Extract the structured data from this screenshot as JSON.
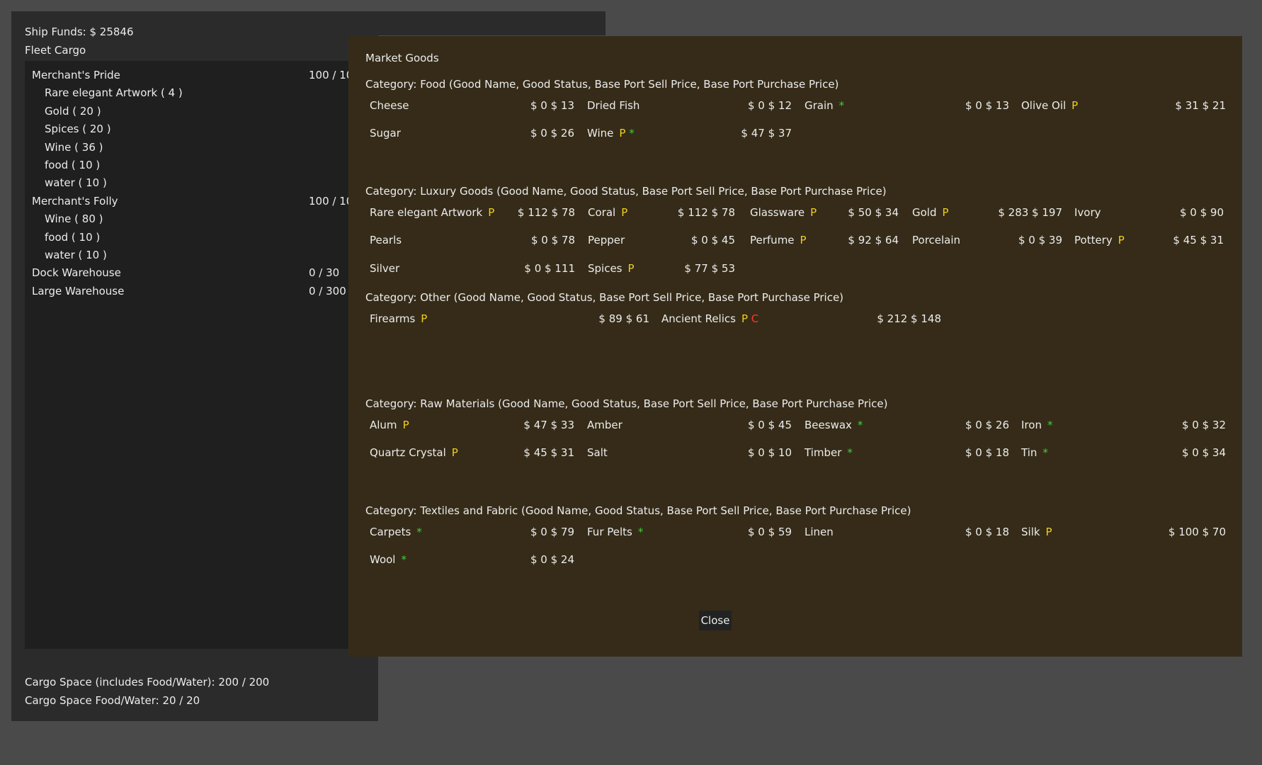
{
  "ship": {
    "funds_label": "Ship Funds: $",
    "funds_value": "25846",
    "fleet_cargo_label": "Fleet  Cargo",
    "cargo_space_label": "Cargo Space (includes Food/Water):",
    "cargo_space_value": "200 / 200",
    "food_water_label": "Cargo Space Food/Water:",
    "food_water_value": "20 / 20"
  },
  "fleet": [
    {
      "name": "Merchant's Pride",
      "capacity": "100 / 10",
      "sub": false
    },
    {
      "name": "Rare elegant Artwork ( 4 )",
      "sub": true
    },
    {
      "name": "Gold ( 20 )",
      "sub": true
    },
    {
      "name": "Spices ( 20 )",
      "sub": true
    },
    {
      "name": "Wine ( 36 )",
      "sub": true
    },
    {
      "name": "food ( 10 )",
      "sub": true
    },
    {
      "name": "water ( 10 )",
      "sub": true
    },
    {
      "name": "Merchant's Folly",
      "capacity": "100 / 10",
      "sub": false
    },
    {
      "name": "Wine ( 80 )",
      "sub": true
    },
    {
      "name": "food ( 10 )",
      "sub": true
    },
    {
      "name": "water ( 10 )",
      "sub": true
    },
    {
      "name": "Dock Warehouse",
      "capacity": "0 / 30",
      "sub": false
    },
    {
      "name": "Large Warehouse",
      "capacity": "0 / 300",
      "sub": false
    }
  ],
  "market": {
    "title": "Market Goods",
    "close_label": "Close",
    "categories": [
      {
        "title": "Category:  Food (Good Name, Good Status, Base Port Sell Price, Base Port Purchase Price)",
        "goods": [
          {
            "name": "Cheese",
            "status": "",
            "price": "$ 0  $ 13"
          },
          {
            "name": "Dried Fish",
            "status": "",
            "price": "$ 0  $ 12"
          },
          {
            "name": "Grain",
            "status": "*",
            "price": "$ 0  $ 13"
          },
          {
            "name": "Olive Oil",
            "status": "P",
            "price": "$ 31  $ 21"
          },
          {
            "name": "Sugar",
            "status": "",
            "price": "$ 0  $ 26"
          },
          {
            "name": "Wine",
            "status": "P *",
            "price": "$ 47  $ 37"
          }
        ]
      },
      {
        "title": "Category:  Luxury Goods (Good Name, Good Status, Base Port Sell Price, Base Port Purchase Price)",
        "goods": [
          {
            "name": "Rare elegant Artwork",
            "status": "P",
            "price": "$ 112  $ 78"
          },
          {
            "name": "Coral",
            "status": "P",
            "price": "$ 112  $ 78"
          },
          {
            "name": "Glassware",
            "status": "P",
            "price": "$ 50  $ 34"
          },
          {
            "name": "Gold",
            "status": "P",
            "price": "$ 283  $ 197"
          },
          {
            "name": "Ivory",
            "status": "",
            "price": "$ 0  $ 90"
          },
          {
            "name": "Pearls",
            "status": "",
            "price": "$ 0  $ 78"
          },
          {
            "name": "Pepper",
            "status": "",
            "price": "$ 0  $ 45"
          },
          {
            "name": "Perfume",
            "status": "P",
            "price": "$ 92  $ 64"
          },
          {
            "name": "Porcelain",
            "status": "",
            "price": "$ 0  $ 39"
          },
          {
            "name": "Pottery",
            "status": "P",
            "price": "$ 45  $ 31"
          },
          {
            "name": "Silver",
            "status": "",
            "price": "$ 0  $ 111"
          },
          {
            "name": "Spices",
            "status": "P",
            "price": "$ 77  $ 53"
          }
        ]
      },
      {
        "title": "Category:  Other (Good Name, Good Status, Base Port Sell Price, Base Port Purchase Price)",
        "goods": [
          {
            "name": "Firearms",
            "status": "P",
            "price": "$ 89  $ 61"
          },
          {
            "name": "Ancient Relics",
            "status": "P C",
            "price": "$ 212  $ 148"
          }
        ]
      },
      {
        "title": "Category:  Raw Materials (Good Name, Good Status, Base Port Sell Price, Base Port Purchase Price)",
        "goods": [
          {
            "name": "Alum",
            "status": "P",
            "price": "$ 47  $ 33"
          },
          {
            "name": "Amber",
            "status": "",
            "price": "$ 0  $ 45"
          },
          {
            "name": "Beeswax",
            "status": "*",
            "price": "$ 0  $ 26"
          },
          {
            "name": "Iron",
            "status": "*",
            "price": "$ 0  $ 32"
          },
          {
            "name": "Quartz Crystal",
            "status": "P",
            "price": "$ 45  $ 31"
          },
          {
            "name": "Salt",
            "status": "",
            "price": "$ 0  $ 10"
          },
          {
            "name": "Timber",
            "status": "*",
            "price": "$ 0  $ 18"
          },
          {
            "name": "Tin",
            "status": "*",
            "price": "$ 0  $ 34"
          }
        ]
      },
      {
        "title": "Category:  Textiles and Fabric (Good Name, Good Status, Base Port Sell Price, Base Port Purchase Price)",
        "goods": [
          {
            "name": "Carpets",
            "status": "*",
            "price": "$ 0  $ 79"
          },
          {
            "name": "Fur Pelts",
            "status": "*",
            "price": "$ 0  $ 59"
          },
          {
            "name": "Linen",
            "status": "",
            "price": "$ 0  $ 18"
          },
          {
            "name": "Silk",
            "status": "P",
            "price": "$ 100  $ 70"
          },
          {
            "name": "Wool",
            "status": "*",
            "price": "$ 0  $ 24"
          }
        ]
      }
    ]
  }
}
